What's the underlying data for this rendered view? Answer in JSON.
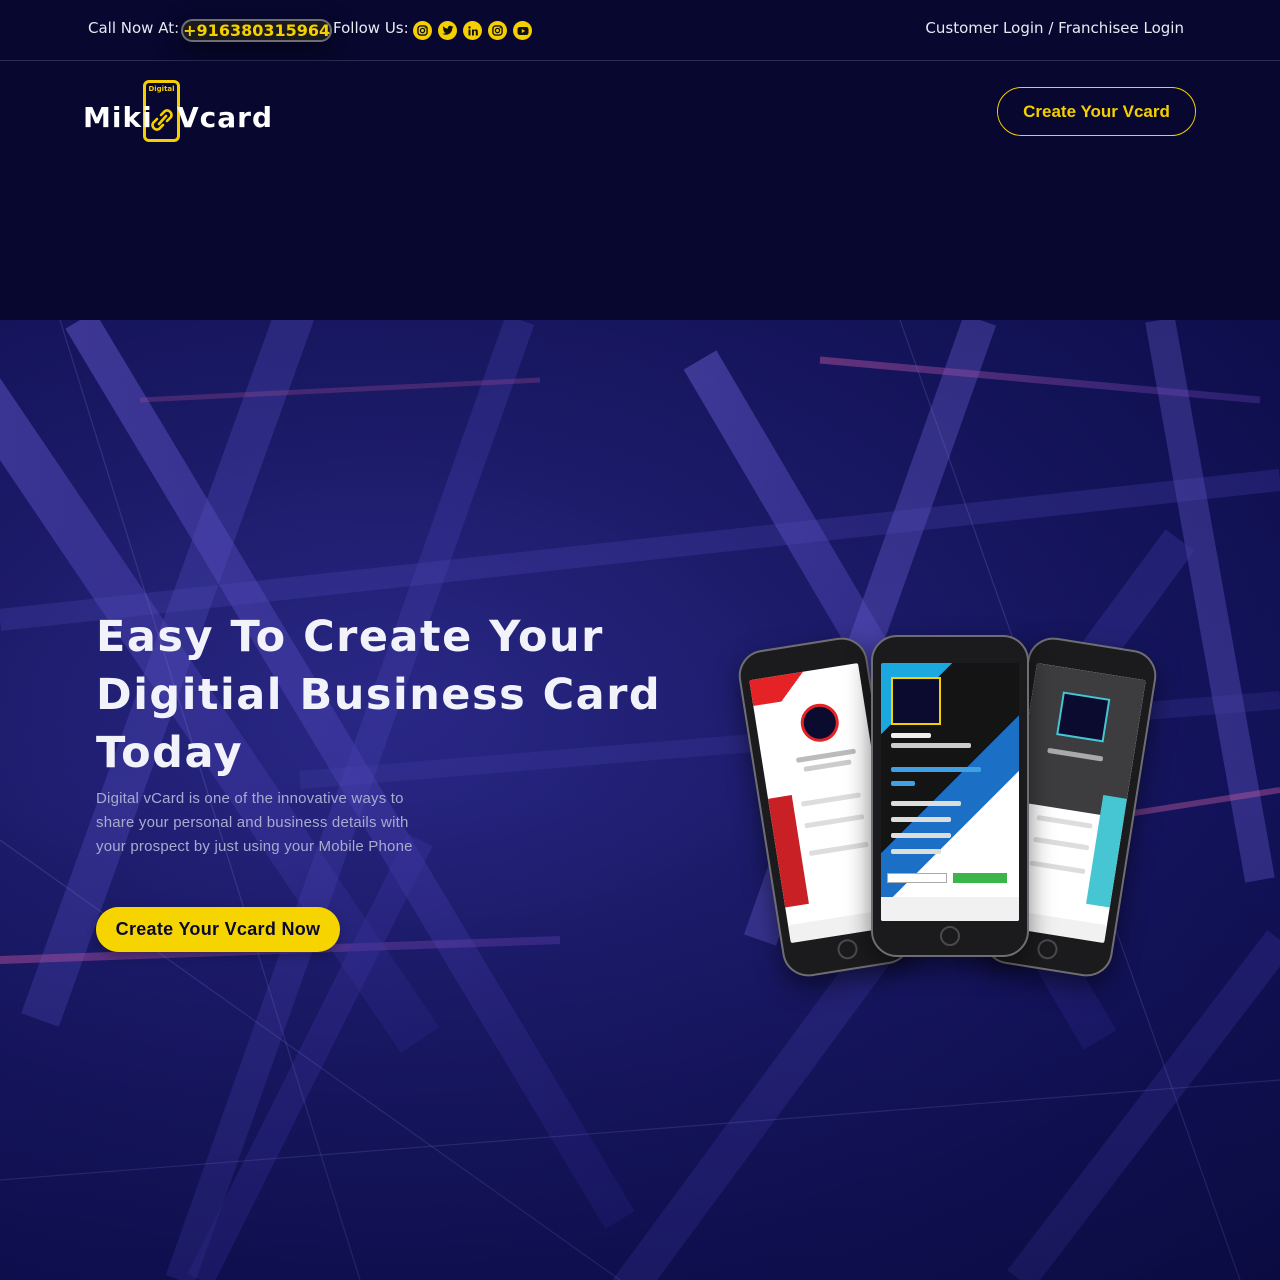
{
  "topbar": {
    "call_label": "Call Now At:",
    "phone": "+916380315964",
    "follow_label": "Follow Us:",
    "social_icons": [
      "instagram-icon",
      "twitter-icon",
      "linkedin-icon",
      "instagram-icon",
      "youtube-icon"
    ],
    "customer_login": "Customer Login",
    "separator": "/",
    "franchisee_login": "Franchisee Login"
  },
  "header": {
    "logo": {
      "small_text": "Digital",
      "left_word": "Miki",
      "right_word": "Vcard"
    },
    "cta_label": "Create Your Vcard"
  },
  "hero": {
    "headline_line1": "Easy To Create Your",
    "headline_line2": "Digitial Business Card",
    "headline_line3": "Today",
    "description": "Digital vCard is one of the innovative ways to share your personal and business details with your prospect by just using your Mobile Phone",
    "cta_label": "Create Your Vcard Now"
  },
  "colors": {
    "accent": "#f5d400",
    "background": "#07072f",
    "hero_blue": "#1d1c6e"
  }
}
